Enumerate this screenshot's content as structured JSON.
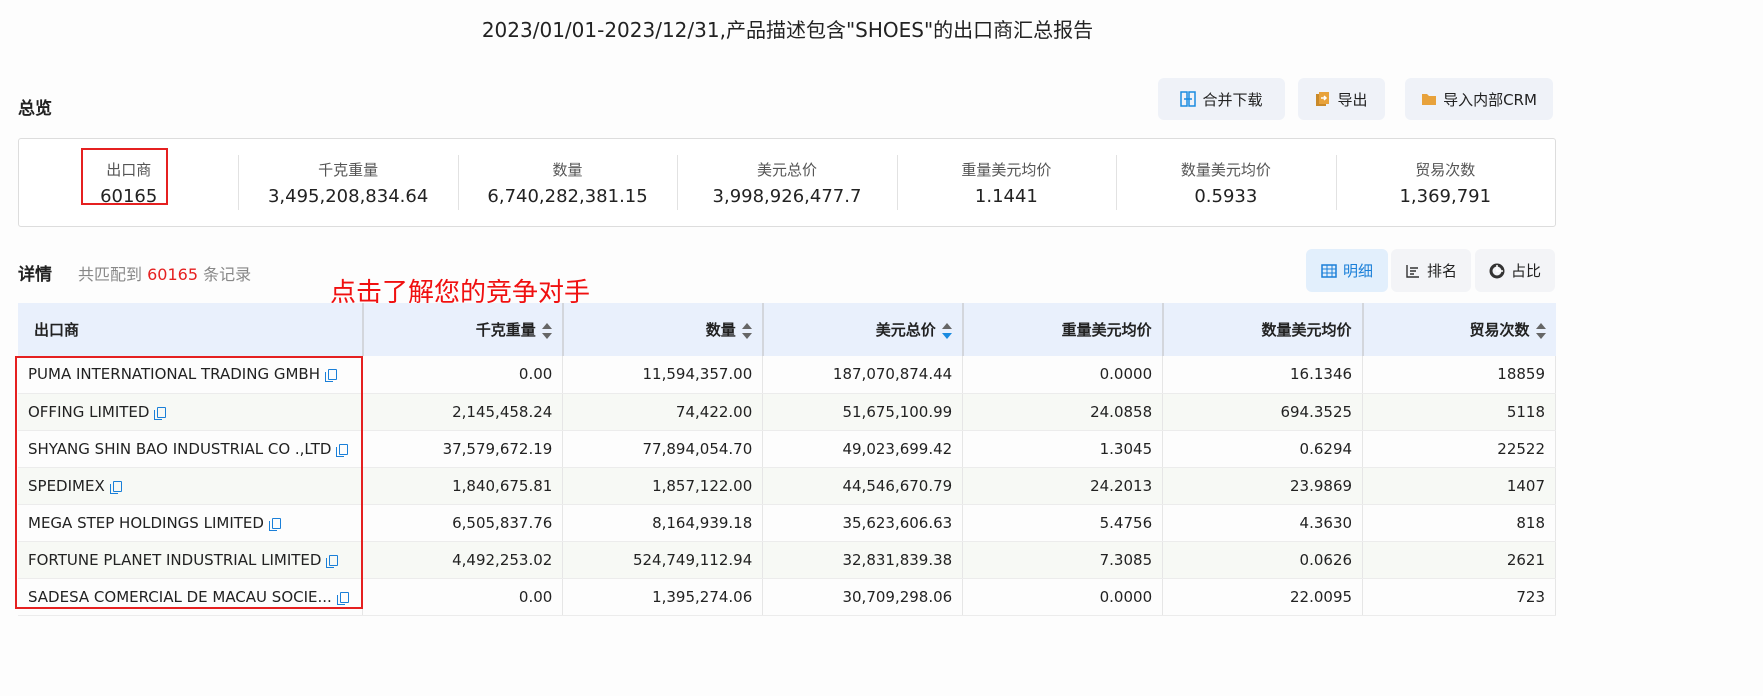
{
  "title": "2023/01/01-2023/12/31,产品描述包含\"SHOES\"的出口商汇总报告",
  "overview": {
    "label": "总览",
    "buttons": [
      {
        "label": "合并下载",
        "icon": "merge-download-icon"
      },
      {
        "label": "导出",
        "icon": "export-icon"
      },
      {
        "label": "导入内部CRM",
        "icon": "import-folder-icon"
      }
    ],
    "stats": [
      {
        "label": "出口商",
        "value": "60165"
      },
      {
        "label": "千克重量",
        "value": "3,495,208,834.64"
      },
      {
        "label": "数量",
        "value": "6,740,282,381.15"
      },
      {
        "label": "美元总价",
        "value": "3,998,926,477.7"
      },
      {
        "label": "重量美元均价",
        "value": "1.1441"
      },
      {
        "label": "数量美元均价",
        "value": "0.5933"
      },
      {
        "label": "贸易次数",
        "value": "1,369,791"
      }
    ]
  },
  "details": {
    "label": "详情",
    "prefix": "共匹配到",
    "count": "60165",
    "suffix": "条记录",
    "annotation": "点击了解您的竞争对手",
    "views": [
      {
        "label": "明细",
        "active": true
      },
      {
        "label": "排名"
      },
      {
        "label": "占比"
      }
    ]
  },
  "table": {
    "columns": [
      "出口商",
      "千克重量",
      "数量",
      "美元总价",
      "重量美元均价",
      "数量美元均价",
      "贸易次数"
    ],
    "sort_active": "美元总价 desc",
    "rows": [
      [
        "PUMA INTERNATIONAL TRADING GMBH",
        "0.00",
        "11,594,357.00",
        "187,070,874.44",
        "0.0000",
        "16.1346",
        "18859"
      ],
      [
        "OFFING LIMITED",
        "2,145,458.24",
        "74,422.00",
        "51,675,100.99",
        "24.0858",
        "694.3525",
        "5118"
      ],
      [
        "SHYANG SHIN BAO INDUSTRIAL CO .,LTD",
        "37,579,672.19",
        "77,894,054.70",
        "49,023,699.42",
        "1.3045",
        "0.6294",
        "22522"
      ],
      [
        "SPEDIMEX",
        "1,840,675.81",
        "1,857,122.00",
        "44,546,670.79",
        "24.2013",
        "23.9869",
        "1407"
      ],
      [
        "MEGA STEP HOLDINGS LIMITED",
        "6,505,837.76",
        "8,164,939.18",
        "35,623,606.63",
        "5.4756",
        "4.3630",
        "818"
      ],
      [
        "FORTUNE PLANET INDUSTRIAL LIMITED",
        "4,492,253.02",
        "524,749,112.94",
        "32,831,839.38",
        "7.3085",
        "0.0626",
        "2621"
      ],
      [
        "SADESA COMERCIAL DE MACAU SOCIE...",
        "0.00",
        "1,395,274.06",
        "30,709,298.06",
        "0.0000",
        "22.0095",
        "723"
      ]
    ]
  }
}
